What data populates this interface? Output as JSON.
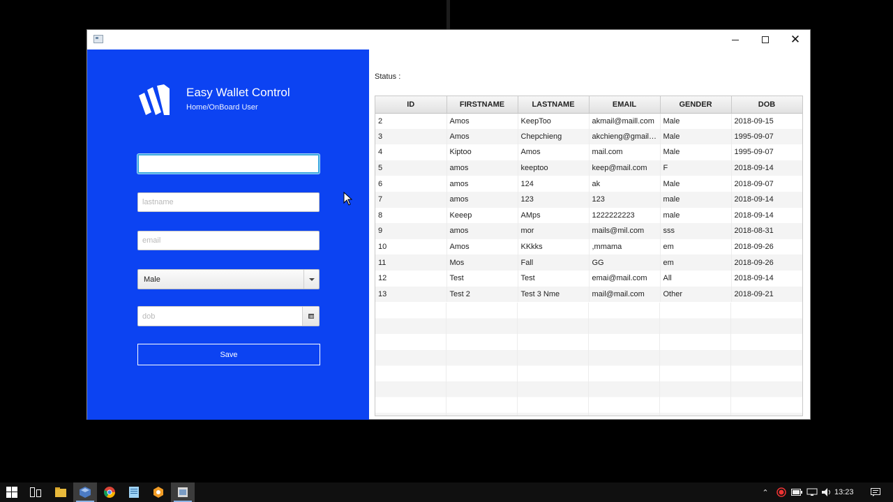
{
  "window": {
    "title_icon": "app-window-icon",
    "controls": {
      "minimize": "minimize-icon",
      "maximize": "maximize-icon",
      "close": "close-icon"
    }
  },
  "left_panel": {
    "background_color": "#0c43f2",
    "logo": "wallet-logo-icon",
    "app_title": "Easy Wallet Control",
    "app_subtitle": "Home/OnBoard User"
  },
  "form": {
    "firstname": {
      "value": "",
      "placeholder": ""
    },
    "lastname": {
      "value": "",
      "placeholder": "lastname"
    },
    "email": {
      "value": "",
      "placeholder": "email"
    },
    "gender": {
      "selected": "Male"
    },
    "dob": {
      "value": "",
      "placeholder": "dob"
    },
    "save_label": "Save"
  },
  "status": {
    "label": "Status :"
  },
  "table": {
    "columns": [
      "ID",
      "FIRSTNAME",
      "LASTNAME",
      "EMAIL",
      "GENDER",
      "DOB"
    ],
    "rows": [
      [
        "2",
        "Amos",
        "KeepToo",
        "akmail@maill.com",
        "Male",
        "2018-09-15"
      ],
      [
        "3",
        "Amos",
        "Chepchieng",
        "akchieng@gmail.com",
        "Male",
        "1995-09-07"
      ],
      [
        "4",
        "Kiptoo",
        "Amos",
        "mail.com",
        "Male",
        "1995-09-07"
      ],
      [
        "5",
        "amos",
        "keeptoo",
        "keep@mail.com",
        "F",
        "2018-09-14"
      ],
      [
        "6",
        "amos",
        "124",
        "ak",
        "Male",
        "2018-09-07"
      ],
      [
        "7",
        "amos",
        "123",
        "123",
        "male",
        "2018-09-14"
      ],
      [
        "8",
        "Keeep",
        "AMps",
        "1222222223",
        "male",
        "2018-09-14"
      ],
      [
        "9",
        "amos",
        "mor",
        "mails@mil.com",
        "sss",
        "2018-08-31"
      ],
      [
        "10",
        "Amos",
        "KKkks",
        ",mmama",
        "em",
        "2018-09-26"
      ],
      [
        "11",
        "Mos",
        "Fall",
        "GG",
        "em",
        "2018-09-26"
      ],
      [
        "12",
        "Test",
        "Test",
        "emai@mail.com",
        "All",
        "2018-09-14"
      ],
      [
        "13",
        "Test 2",
        "Test 3 Nme",
        "mail@mail.com",
        "Other",
        "2018-09-21"
      ]
    ]
  },
  "taskbar": {
    "items": [
      "windows-start-icon",
      "task-view-icon",
      "file-explorer-icon",
      "virtualbox-icon",
      "chrome-icon",
      "notepad-icon",
      "scene-builder-icon",
      "java-app-icon"
    ],
    "tray_icons": [
      "chevron-up-icon",
      "record-icon",
      "battery-icon",
      "network-icon",
      "volume-icon"
    ],
    "clock": "13:23",
    "notification_icon": "notification-icon"
  }
}
